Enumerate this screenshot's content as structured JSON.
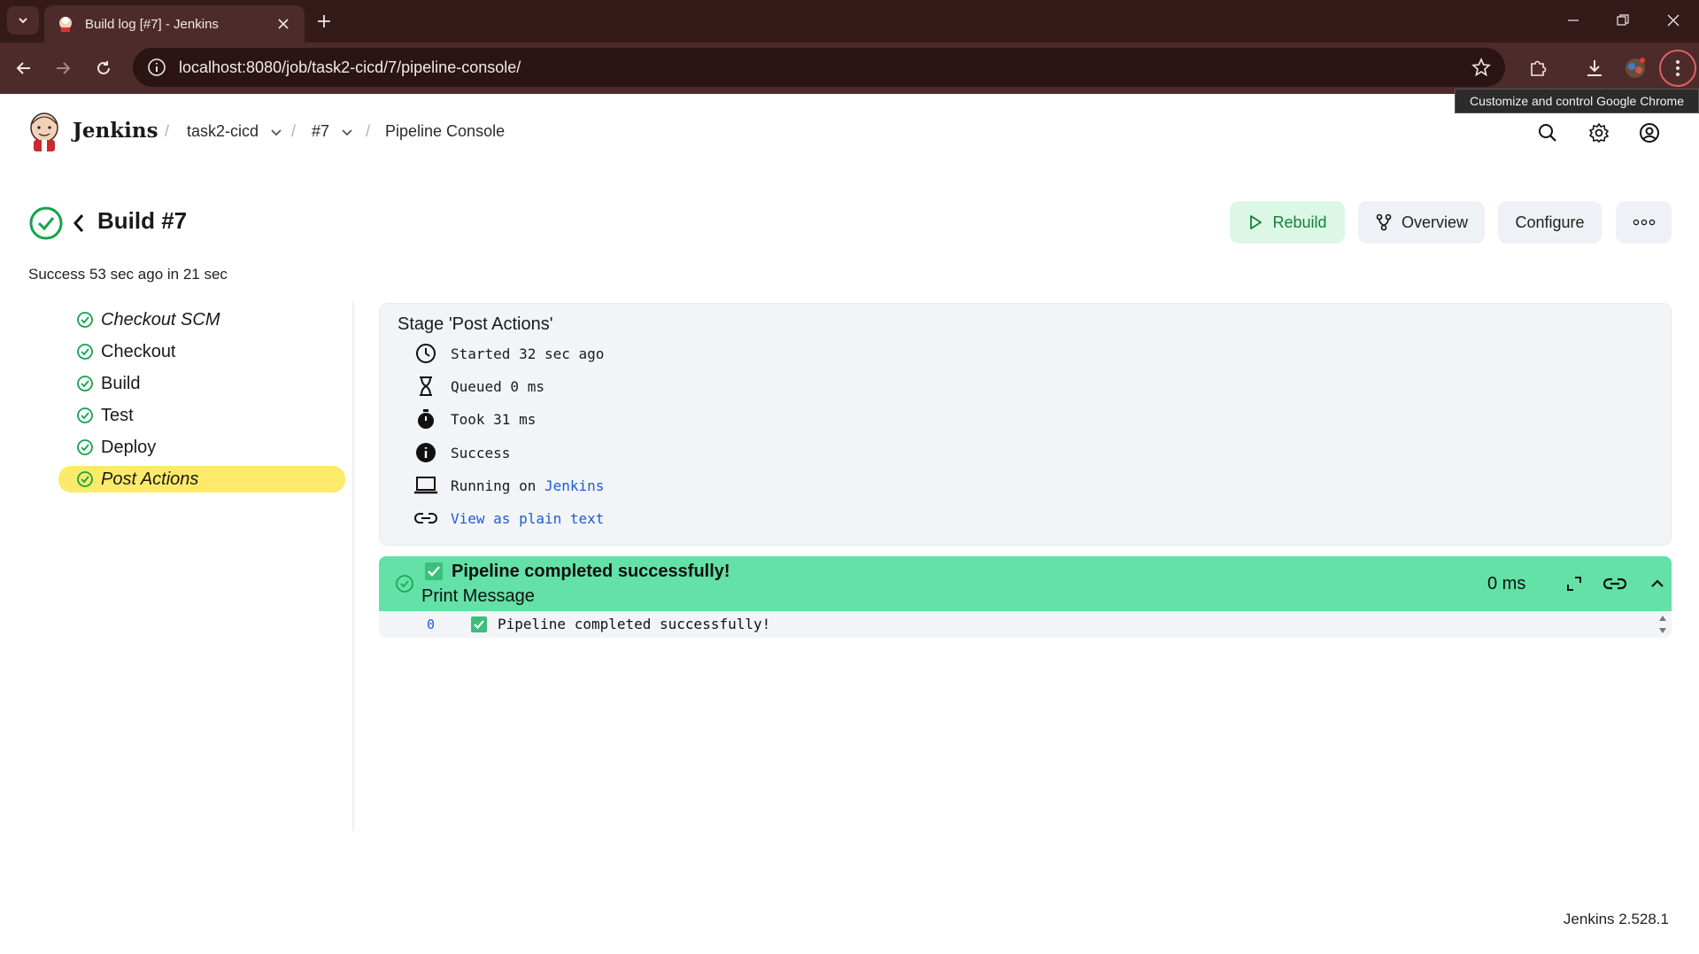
{
  "browser": {
    "tab_title": "Build log [#7] - Jenkins",
    "url": "localhost:8080/job/task2-cicd/7/pipeline-console/",
    "tooltip": "Customize and control Google Chrome"
  },
  "header": {
    "brand": "Jenkins",
    "breadcrumbs": [
      {
        "label": "task2-cicd"
      },
      {
        "label": "#7"
      },
      {
        "label": "Pipeline Console"
      }
    ]
  },
  "build": {
    "title": "Build #7",
    "subtitle": "Success 53 sec ago in 21 sec",
    "actions": {
      "rebuild": "Rebuild",
      "overview": "Overview",
      "configure": "Configure"
    }
  },
  "stages": [
    {
      "label": "Checkout SCM",
      "italic": true,
      "active": false
    },
    {
      "label": "Checkout",
      "italic": false,
      "active": false
    },
    {
      "label": "Build",
      "italic": false,
      "active": false
    },
    {
      "label": "Test",
      "italic": false,
      "active": false
    },
    {
      "label": "Deploy",
      "italic": false,
      "active": false
    },
    {
      "label": "Post Actions",
      "italic": true,
      "active": true
    }
  ],
  "stage_detail": {
    "title": "Stage 'Post Actions'",
    "started": "Started 32 sec ago",
    "queued": "Queued 0 ms",
    "took": "Took 31 ms",
    "status": "Success",
    "running_on_prefix": "Running on",
    "running_on_node": "Jenkins",
    "plain_text_link": "View as plain text"
  },
  "step": {
    "title": "Pipeline completed successfully!",
    "subtitle": "Print Message",
    "duration": "0 ms",
    "log_lines": [
      {
        "number": "0",
        "text": "Pipeline completed successfully!"
      }
    ]
  },
  "footer": {
    "version": "Jenkins 2.528.1"
  },
  "colors": {
    "success_green": "#15a34a",
    "step_bar": "#63e1a6",
    "active_stage": "#fdea6a",
    "link_blue": "#1f5bd6",
    "chrome_frame": "#351a1a"
  }
}
